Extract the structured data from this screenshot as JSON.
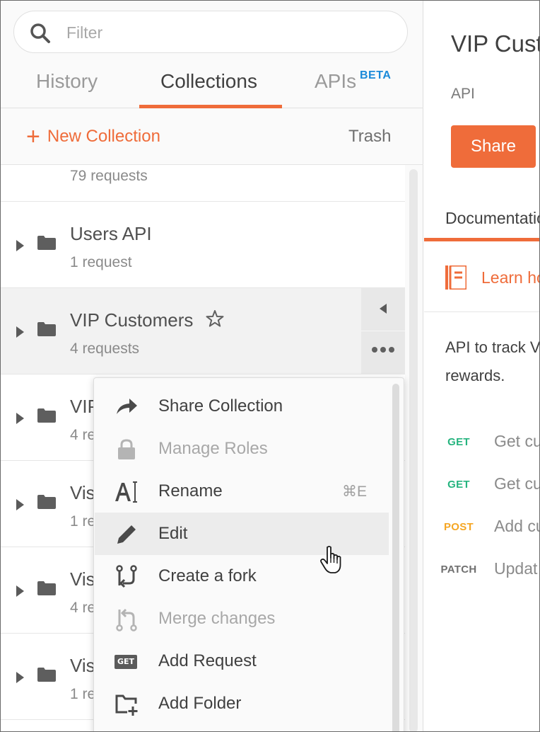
{
  "search": {
    "placeholder": "Filter"
  },
  "tabs": [
    {
      "label": "History",
      "active": false
    },
    {
      "label": "Collections",
      "active": true
    },
    {
      "label": "APIs",
      "active": false,
      "badge": "BETA"
    }
  ],
  "actions": {
    "new_collection": "New Collection",
    "trash": "Trash"
  },
  "collections": [
    {
      "name": "",
      "count": "79 requests"
    },
    {
      "name": "Users API",
      "count": "1 request"
    },
    {
      "name": "VIP Customers",
      "count": "4 requests",
      "selected": true,
      "starred": false
    },
    {
      "name": "VIP",
      "count": "4 re"
    },
    {
      "name": "Vis",
      "count": "1 re"
    },
    {
      "name": "Vis",
      "count": "4 re"
    },
    {
      "name": "Vis",
      "count": "1 re"
    }
  ],
  "context_menu": {
    "items": [
      {
        "label": "Share Collection",
        "icon": "share-arrow-icon",
        "disabled": false
      },
      {
        "label": "Manage Roles",
        "icon": "lock-icon",
        "disabled": true
      },
      {
        "label": "Rename",
        "icon": "rename-icon",
        "disabled": false,
        "shortcut": "⌘E"
      },
      {
        "label": "Edit",
        "icon": "pencil-icon",
        "disabled": false,
        "hovered": true
      },
      {
        "label": "Create a fork",
        "icon": "fork-icon",
        "disabled": false
      },
      {
        "label": "Merge changes",
        "icon": "merge-icon",
        "disabled": true
      },
      {
        "label": "Add Request",
        "icon": "get-badge-icon",
        "disabled": false,
        "badge": "GET"
      },
      {
        "label": "Add Folder",
        "icon": "add-folder-icon",
        "disabled": false
      }
    ]
  },
  "main": {
    "title": "VIP Customers",
    "type": "API",
    "share_label": "Share",
    "doc_tab": "Documentation",
    "learn_text": "Learn how",
    "description": "API to track VIP rewards.",
    "requests": [
      {
        "method": "GET",
        "name": "Get cu",
        "color": "#26b47f"
      },
      {
        "method": "GET",
        "name": "Get cu",
        "color": "#26b47f"
      },
      {
        "method": "POST",
        "name": "Add cu",
        "color": "#f5a623"
      },
      {
        "method": "PATCH",
        "name": "Updat",
        "color": "#707070"
      }
    ]
  },
  "colors": {
    "accent": "#ef6c3a",
    "beta": "#1a8ad9"
  }
}
